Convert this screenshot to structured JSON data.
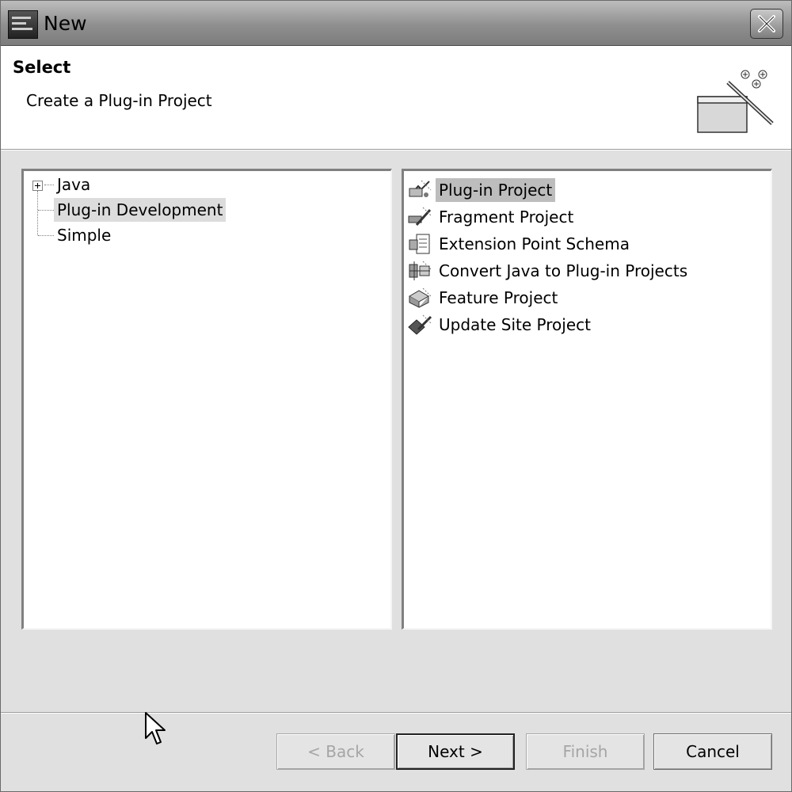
{
  "window": {
    "title": "New",
    "close_icon": "close-icon",
    "app_icon": "eclipse-icon"
  },
  "banner": {
    "title": "Select",
    "description": "Create a Plug-in Project",
    "icon": "wizard-icon"
  },
  "tree": {
    "items": [
      {
        "label": "Java",
        "expandable": true,
        "selected": false
      },
      {
        "label": "Plug-in Development",
        "expandable": false,
        "selected": true
      },
      {
        "label": "Simple",
        "expandable": false,
        "selected": false
      }
    ]
  },
  "wizards": {
    "items": [
      {
        "label": "Plug-in Project",
        "icon": "plugin-project-icon",
        "selected": true
      },
      {
        "label": "Fragment Project",
        "icon": "fragment-project-icon",
        "selected": false
      },
      {
        "label": "Extension Point Schema",
        "icon": "schema-icon",
        "selected": false
      },
      {
        "label": "Convert Java to Plug-in Projects",
        "icon": "convert-icon",
        "selected": false
      },
      {
        "label": "Feature Project",
        "icon": "feature-project-icon",
        "selected": false
      },
      {
        "label": "Update Site Project",
        "icon": "update-site-icon",
        "selected": false
      }
    ]
  },
  "buttons": {
    "back": {
      "label": "< Back",
      "enabled": false
    },
    "next": {
      "label": "Next >",
      "enabled": true
    },
    "finish": {
      "label": "Finish",
      "enabled": false
    },
    "cancel": {
      "label": "Cancel",
      "enabled": true
    }
  },
  "colors": {
    "selection": "#bdbdbd",
    "title_bar": "#8f8f8f"
  }
}
